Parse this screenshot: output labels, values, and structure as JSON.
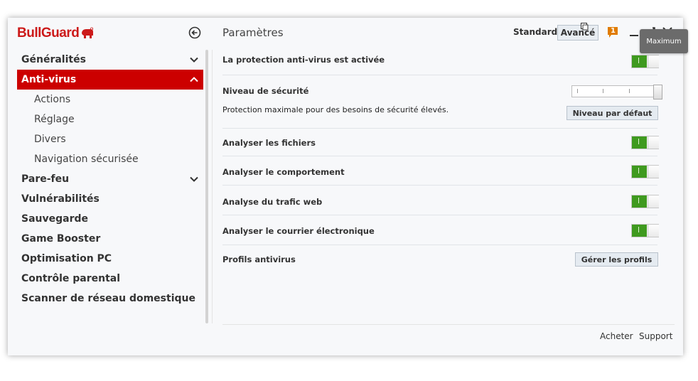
{
  "app": {
    "name": "BullGuard"
  },
  "header": {
    "title": "Paramètres",
    "mode_standard": "Standard",
    "mode_advanced": "Avancé",
    "notification_count": "1",
    "tooltip": "Maximum"
  },
  "sidebar": {
    "items": [
      {
        "label": "Généralités",
        "expanded": false,
        "has_chevron": true
      },
      {
        "label": "Anti-virus",
        "expanded": true,
        "active": true,
        "has_chevron": true,
        "children": [
          "Actions",
          "Réglage",
          "Divers",
          "Navigation sécurisée"
        ]
      },
      {
        "label": "Pare-feu",
        "has_chevron": true
      },
      {
        "label": "Vulnérabilités"
      },
      {
        "label": "Sauvegarde"
      },
      {
        "label": "Game Booster"
      },
      {
        "label": "Optimisation PC"
      },
      {
        "label": "Contrôle parental"
      },
      {
        "label": "Scanner de réseau domestique"
      }
    ]
  },
  "settings": {
    "protection": {
      "label": "La protection anti-virus est activée",
      "on": true
    },
    "security_level": {
      "label": "Niveau de sécurité",
      "description": "Protection maximale pour des besoins de sécurité élevés.",
      "default_button": "Niveau par défaut",
      "level": "Maximum"
    },
    "scan_files": {
      "label": "Analyser les fichiers",
      "on": true
    },
    "scan_behavior": {
      "label": "Analyser le comportement",
      "on": true
    },
    "scan_web": {
      "label": "Analyse du trafic web",
      "on": true
    },
    "scan_email": {
      "label": "Analyser le courrier électronique",
      "on": true
    },
    "profiles": {
      "label": "Profils antivirus",
      "button": "Gérer les profils"
    }
  },
  "footer": {
    "buy": "Acheter",
    "support": "Support"
  },
  "colors": {
    "accent": "#cc0000",
    "toggle_on": "#3f9a1f",
    "notification": "#e07b00"
  }
}
